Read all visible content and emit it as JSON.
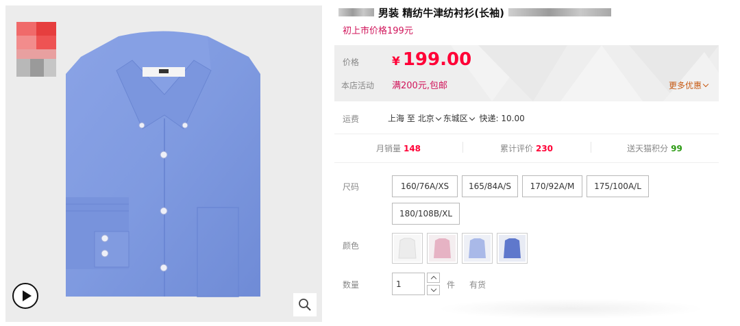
{
  "gallery": {
    "main_image_alt": "",
    "play_icon": "play-icon",
    "zoom_icon": "magnifier-icon"
  },
  "product": {
    "title": "男装 精纺牛津纺衬衫(长袖)",
    "subtitle": "初上市价格199元"
  },
  "price": {
    "label": "价格",
    "currency": "¥",
    "amount": "199.00"
  },
  "promotion": {
    "label": "本店活动",
    "text": "满200元,包邮",
    "more_label": "更多优惠"
  },
  "shipping": {
    "label": "运费",
    "from": "上海",
    "to_word": "至",
    "city": "北京",
    "district": "东城区",
    "method": "快递: 10.00"
  },
  "stats": [
    {
      "label": "月销量",
      "value": "148",
      "color": "red"
    },
    {
      "label": "累计评价",
      "value": "230",
      "color": "red"
    },
    {
      "label": "送天猫积分",
      "value": "99",
      "color": "green"
    }
  ],
  "size": {
    "label": "尺码",
    "options": [
      "160/76A/XS",
      "165/84A/S",
      "170/92A/M",
      "175/100A/L",
      "180/108B/XL"
    ]
  },
  "color": {
    "label": "颜色",
    "swatches": [
      {
        "name": "white",
        "hex": "#f4f4f4"
      },
      {
        "name": "pink",
        "hex": "#e8b8c8"
      },
      {
        "name": "light-blue",
        "hex": "#a9b9e8"
      },
      {
        "name": "blue",
        "hex": "#5f78cc"
      }
    ]
  },
  "quantity": {
    "label": "数量",
    "value": "1",
    "unit": "件",
    "stock": "有货"
  },
  "colors": {
    "price_red": "#ff0036",
    "promo_pink": "#d0145a",
    "more_orange": "#c75a13",
    "points_green": "#2a9a12",
    "shirt_blue": "#7f9ae0"
  }
}
